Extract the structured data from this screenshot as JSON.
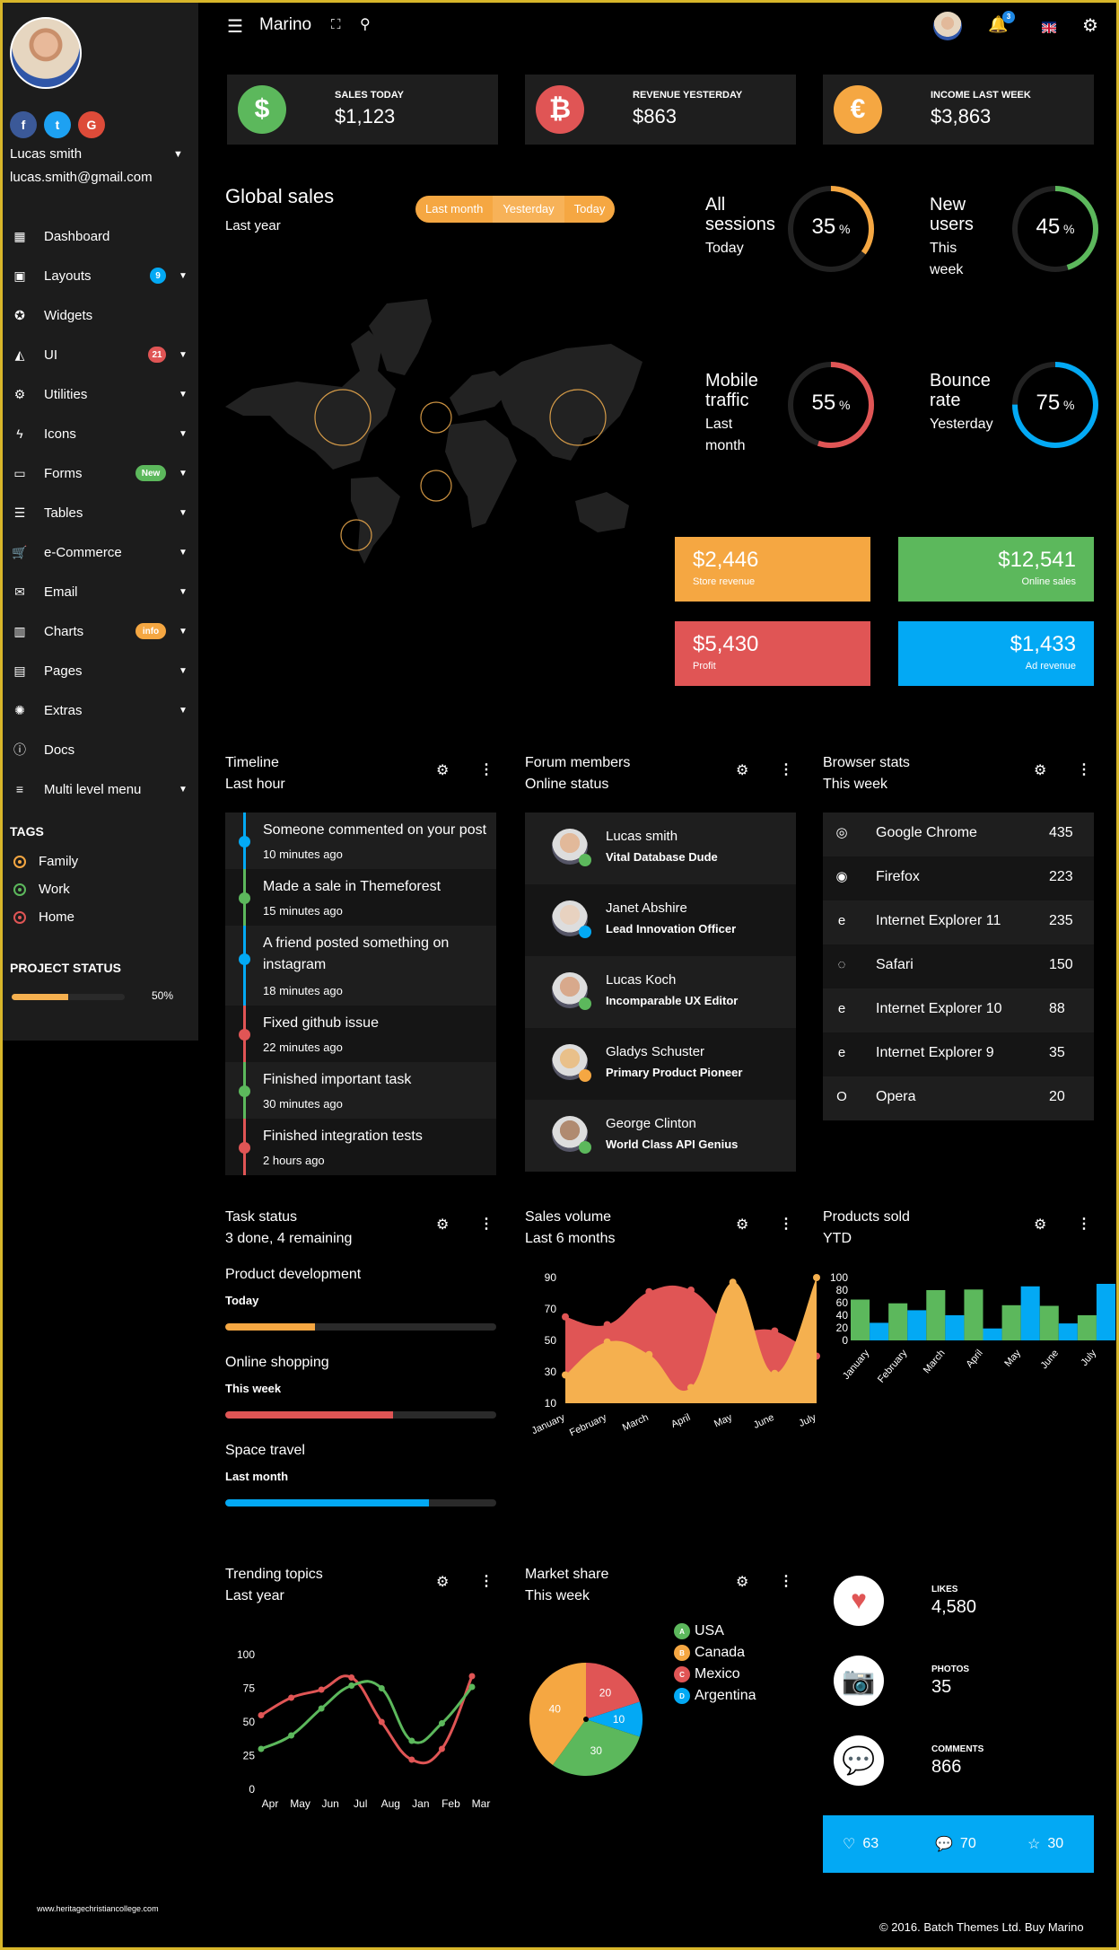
{
  "colors": {
    "green": "#5cb85c",
    "red": "#e05555",
    "orange": "#f5a742",
    "blue": "#03a9f4",
    "panel": "#1c1c1c"
  },
  "sidebar": {
    "user": {
      "name": "Lucas smith",
      "email": "lucas.smith@gmail.com"
    },
    "social": [
      {
        "icon": "facebook-icon",
        "glyph": "f",
        "color": "#3b5998"
      },
      {
        "icon": "twitter-icon",
        "glyph": "t",
        "color": "#1da1f2"
      },
      {
        "icon": "google-icon",
        "glyph": "G",
        "color": "#dd4b39"
      }
    ],
    "items": [
      {
        "label": "Dashboard",
        "icon": "dashboard-icon",
        "glyph": "▦",
        "badge": null,
        "caret": false
      },
      {
        "label": "Layouts",
        "icon": "layouts-icon",
        "glyph": "▣",
        "badge": {
          "text": "9",
          "color": "#03a9f4"
        },
        "caret": true
      },
      {
        "label": "Widgets",
        "icon": "widgets-icon",
        "glyph": "✪",
        "badge": null,
        "caret": false
      },
      {
        "label": "UI",
        "icon": "ui-icon",
        "glyph": "◭",
        "badge": {
          "text": "21",
          "color": "#e05555"
        },
        "caret": true
      },
      {
        "label": "Utilities",
        "icon": "gear-icon",
        "glyph": "⚙",
        "badge": null,
        "caret": true
      },
      {
        "label": "Icons",
        "icon": "bolt-icon",
        "glyph": "ϟ",
        "badge": null,
        "caret": true
      },
      {
        "label": "Forms",
        "icon": "folder-icon",
        "glyph": "▭",
        "badge": {
          "text": "New",
          "color": "#5cb85c"
        },
        "caret": true
      },
      {
        "label": "Tables",
        "icon": "list-icon",
        "glyph": "☰",
        "badge": null,
        "caret": true
      },
      {
        "label": "e-Commerce",
        "icon": "cart-icon",
        "glyph": "🛒",
        "badge": null,
        "caret": true
      },
      {
        "label": "Email",
        "icon": "email-icon",
        "glyph": "✉",
        "badge": null,
        "caret": true
      },
      {
        "label": "Charts",
        "icon": "chart-icon",
        "glyph": "▥",
        "badge": {
          "text": "info",
          "color": "#f5a742"
        },
        "caret": true
      },
      {
        "label": "Pages",
        "icon": "page-icon",
        "glyph": "▤",
        "badge": null,
        "caret": true
      },
      {
        "label": "Extras",
        "icon": "bulb-icon",
        "glyph": "✺",
        "badge": null,
        "caret": true
      },
      {
        "label": "Docs",
        "icon": "info-icon",
        "glyph": "ⓘ",
        "badge": null,
        "caret": false
      },
      {
        "label": "Multi level menu",
        "icon": "filter-icon",
        "glyph": "≡",
        "badge": null,
        "caret": true
      }
    ],
    "tags_title": "TAGS",
    "tags": [
      {
        "label": "Family",
        "color": "#f5a742"
      },
      {
        "label": "Work",
        "color": "#5cb85c"
      },
      {
        "label": "Home",
        "color": "#e05555"
      }
    ],
    "project_status": {
      "title": "PROJECT STATUS",
      "percent": 50,
      "label": "50%"
    }
  },
  "topbar": {
    "title": "Marino",
    "notifications": "3"
  },
  "stat_cards": [
    {
      "label": "SALES TODAY",
      "value": "$1,123",
      "icon": "dollar-icon",
      "glyph": "$",
      "color": "#5cb85c"
    },
    {
      "label": "REVENUE YESTERDAY",
      "value": "$863",
      "icon": "bitcoin-icon",
      "glyph": "₿",
      "color": "#e05555"
    },
    {
      "label": "INCOME LAST WEEK",
      "value": "$3,863",
      "icon": "euro-icon",
      "glyph": "€",
      "color": "#f5a742"
    }
  ],
  "global_sales": {
    "title": "Global sales",
    "subtitle": "Last year",
    "tabs": [
      "Last month",
      "Yesterday",
      "Today"
    ],
    "active_tab": 1
  },
  "donuts": [
    {
      "title_lines": [
        "All",
        "sessions"
      ],
      "sub_lines": [
        "Today"
      ],
      "value": 35,
      "color": "#f5a742"
    },
    {
      "title_lines": [
        "New",
        "users"
      ],
      "sub_lines": [
        "This",
        "week"
      ],
      "value": 45,
      "color": "#5cb85c"
    },
    {
      "title_lines": [
        "Mobile",
        "traffic"
      ],
      "sub_lines": [
        "Last",
        "month"
      ],
      "value": 55,
      "color": "#e05555"
    },
    {
      "title_lines": [
        "Bounce",
        "rate"
      ],
      "sub_lines": [
        "Yesterday"
      ],
      "value": 75,
      "color": "#03a9f4"
    }
  ],
  "tiles": [
    {
      "value": "$2,446",
      "label": "Store revenue",
      "color": "#f5a742",
      "align": "left"
    },
    {
      "value": "$12,541",
      "label": "Online sales",
      "color": "#5cb85c",
      "align": "right"
    },
    {
      "value": "$5,430",
      "label": "Profit",
      "color": "#e05555",
      "align": "left"
    },
    {
      "value": "$1,433",
      "label": "Ad revenue",
      "color": "#03a9f4",
      "align": "right"
    }
  ],
  "timeline": {
    "title": "Timeline",
    "subtitle": "Last hour",
    "items": [
      {
        "text": "Someone commented on your post",
        "time": "10 minutes ago",
        "color": "#03a9f4"
      },
      {
        "text": "Made a sale in Themeforest",
        "time": "15 minutes ago",
        "color": "#5cb85c"
      },
      {
        "text": "A friend posted something on instagram",
        "time": "18 minutes ago",
        "color": "#03a9f4"
      },
      {
        "text": "Fixed github issue",
        "time": "22 minutes ago",
        "color": "#e05555"
      },
      {
        "text": "Finished important task",
        "time": "30 minutes ago",
        "color": "#5cb85c"
      },
      {
        "text": "Finished integration tests",
        "time": "2 hours ago",
        "color": "#e05555"
      }
    ]
  },
  "members": {
    "title": "Forum members",
    "subtitle": "Online status",
    "items": [
      {
        "name": "Lucas smith",
        "role": "Vital Database Dude",
        "status": "#5cb85c"
      },
      {
        "name": "Janet Abshire",
        "role": "Lead Innovation Officer",
        "status": "#03a9f4"
      },
      {
        "name": "Lucas Koch",
        "role": "Incomparable UX Editor",
        "status": "#5cb85c"
      },
      {
        "name": "Gladys Schuster",
        "role": "Primary Product Pioneer",
        "status": "#f5a742"
      },
      {
        "name": "George Clinton",
        "role": "World Class API Genius",
        "status": "#5cb85c"
      }
    ]
  },
  "browsers": {
    "title": "Browser stats",
    "subtitle": "This week",
    "items": [
      {
        "name": "Google Chrome",
        "value": "435",
        "icon": "chrome-icon",
        "glyph": "◎"
      },
      {
        "name": "Firefox",
        "value": "223",
        "icon": "firefox-icon",
        "glyph": "◉"
      },
      {
        "name": "Internet Explorer 11",
        "value": "235",
        "icon": "ie-icon",
        "glyph": "e"
      },
      {
        "name": "Safari",
        "value": "150",
        "icon": "safari-icon",
        "glyph": "◌"
      },
      {
        "name": "Internet Explorer 10",
        "value": "88",
        "icon": "ie-icon",
        "glyph": "e"
      },
      {
        "name": "Internet Explorer 9",
        "value": "35",
        "icon": "ie-icon",
        "glyph": "e"
      },
      {
        "name": "Opera",
        "value": "20",
        "icon": "opera-icon",
        "glyph": "O"
      }
    ]
  },
  "tasks": {
    "title": "Task status",
    "subtitle": "3 done, 4 remaining",
    "items": [
      {
        "name": "Product development",
        "when": "Today",
        "percent": 33,
        "color": "#f5a742"
      },
      {
        "name": "Online shopping",
        "when": "This week",
        "percent": 62,
        "color": "#e05555"
      },
      {
        "name": "Space travel",
        "when": "Last month",
        "percent": 75,
        "color": "#03a9f4"
      }
    ]
  },
  "sales_volume": {
    "title": "Sales volume",
    "subtitle": "Last 6 months"
  },
  "products_sold": {
    "title": "Products sold",
    "subtitle": "YTD"
  },
  "trending": {
    "title": "Trending topics",
    "subtitle": "Last year"
  },
  "market": {
    "title": "Market share",
    "subtitle": "This week"
  },
  "chart_data": [
    {
      "type": "area",
      "title": "Sales volume",
      "categories": [
        "January",
        "February",
        "March",
        "April",
        "May",
        "June",
        "July"
      ],
      "ylim": [
        10,
        90
      ],
      "yticks": [
        10,
        30,
        50,
        70,
        90
      ],
      "series": [
        {
          "name": "A",
          "color": "#e05555",
          "values": [
            65,
            60,
            81,
            82,
            58,
            56,
            40
          ]
        },
        {
          "name": "B",
          "color": "#f5b04f",
          "values": [
            28,
            49,
            41,
            20,
            87,
            29,
            90
          ]
        }
      ]
    },
    {
      "type": "bar",
      "title": "Products sold",
      "categories": [
        "January",
        "February",
        "March",
        "April",
        "May",
        "June",
        "July"
      ],
      "ylim": [
        0,
        100
      ],
      "yticks": [
        0,
        20,
        40,
        60,
        80,
        100
      ],
      "series": [
        {
          "name": "A",
          "color": "#5cb85c",
          "values": [
            65,
            59,
            80,
            81,
            56,
            55,
            40
          ]
        },
        {
          "name": "B",
          "color": "#03a9f4",
          "values": [
            28,
            48,
            40,
            19,
            86,
            27,
            90
          ]
        }
      ]
    },
    {
      "type": "line",
      "title": "Trending topics",
      "categories": [
        "Apr",
        "May",
        "Jun",
        "Jul",
        "Aug",
        "Jan",
        "Feb",
        "Mar"
      ],
      "ylim": [
        0,
        100
      ],
      "yticks": [
        0,
        25,
        50,
        75,
        100
      ],
      "series": [
        {
          "name": "A",
          "color": "#e05555",
          "values": [
            55,
            68,
            74,
            83,
            50,
            22,
            30,
            84
          ]
        },
        {
          "name": "B",
          "color": "#5cb85c",
          "values": [
            30,
            40,
            60,
            77,
            75,
            36,
            49,
            76
          ]
        }
      ]
    },
    {
      "type": "pie",
      "title": "Market share",
      "slices": [
        {
          "label": "USA",
          "letter": "A",
          "value": 30,
          "color": "#5cb85c"
        },
        {
          "label": "Canada",
          "letter": "B",
          "value": 40,
          "color": "#f5a742"
        },
        {
          "label": "Mexico",
          "letter": "C",
          "value": 20,
          "color": "#e05555"
        },
        {
          "label": "Argentina",
          "letter": "D",
          "value": 10,
          "color": "#03a9f4"
        }
      ]
    }
  ],
  "social_stats": [
    {
      "label": "LIKES",
      "value": "4,580",
      "icon": "heart-icon",
      "color": "#e05555"
    },
    {
      "label": "PHOTOS",
      "value": "35",
      "icon": "camera-icon",
      "color": "#5cb85c"
    },
    {
      "label": "COMMENTS",
      "value": "866",
      "icon": "comment-icon",
      "color": "#f5a742"
    }
  ],
  "footer_bar": [
    {
      "icon": "heart-outline-icon",
      "glyph": "♡",
      "value": "63"
    },
    {
      "icon": "comment-outline-icon",
      "glyph": "💬",
      "value": "70"
    },
    {
      "icon": "star-outline-icon",
      "glyph": "☆",
      "value": "30"
    }
  ],
  "watermark": "www.heritagechristiancollege.com",
  "copyright": "© 2016. Batch Themes Ltd. Buy Marino"
}
